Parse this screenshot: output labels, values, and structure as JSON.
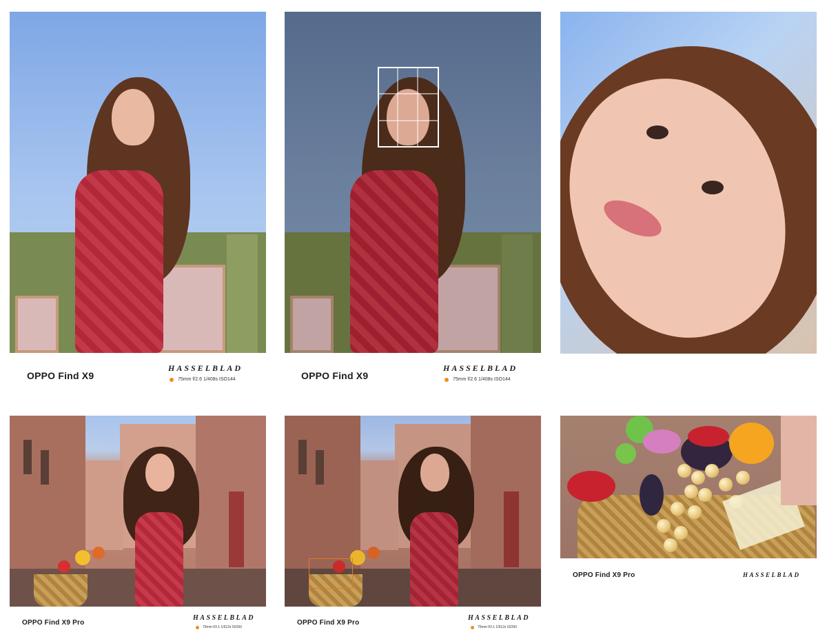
{
  "captions": [
    {
      "model": "OPPO Find X9",
      "brand": "HASSELBLAD",
      "exif": "75mm  f/2.6  1/408s  ISO144"
    },
    {
      "model": "OPPO Find X9",
      "brand": "HASSELBLAD",
      "exif": "75mm  f/2.6  1/408s  ISO144"
    },
    {
      "model": "OPPO Find X9 Pro",
      "brand": "HASSELBLAD",
      "exif": "75mm  f/3.1  1/612s  ISO50"
    },
    {
      "model": "OPPO Find X9 Pro",
      "brand": "HASSELBLAD",
      "exif": "75mm  f/3.1  1/612s  ISO50"
    },
    {
      "model": "OPPO Find X9 Pro",
      "brand": "HASSELBLAD"
    }
  ],
  "colors": {
    "accent_dot": "#f28c1b",
    "dress": "#b2283a",
    "hair": "#5a331f"
  }
}
